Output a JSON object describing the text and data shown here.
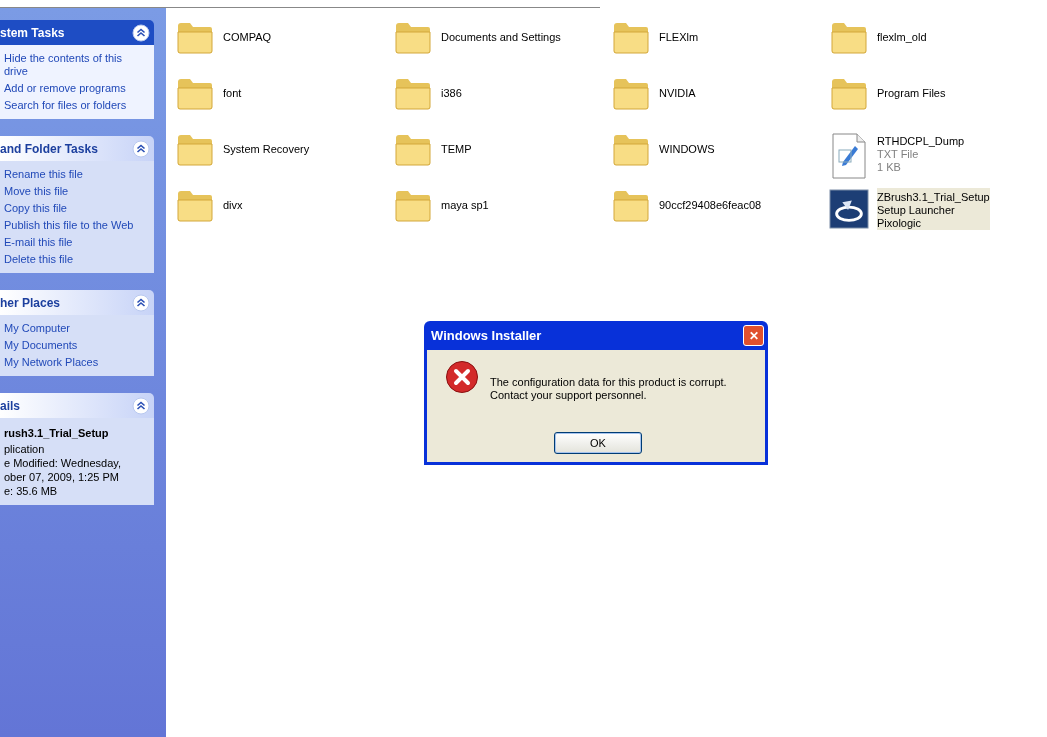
{
  "sidebar": {
    "sections": [
      {
        "title": "stem Tasks",
        "special": true,
        "kind": "links",
        "links": [
          "Hide the contents of this drive",
          "Add or remove programs",
          "Search for files or folders"
        ]
      },
      {
        "title": "and Folder Tasks",
        "special": false,
        "kind": "links",
        "links": [
          "Rename this file",
          "Move this file",
          "Copy this file",
          "Publish this file to the Web",
          "E-mail this file",
          "Delete this file"
        ]
      },
      {
        "title": "her Places",
        "special": false,
        "kind": "links",
        "links": [
          "My Computer",
          "My Documents",
          "My Network Places"
        ]
      },
      {
        "title": "ails",
        "special": false,
        "kind": "details",
        "name": "rush3.1_Trial_Setup",
        "lines": [
          "plication",
          "e Modified: Wednesday,",
          "ober 07, 2009, 1:25 PM",
          "e: 35.6 MB"
        ]
      }
    ]
  },
  "files": [
    {
      "kind": "folder",
      "name": "COMPAQ",
      "selected": false
    },
    {
      "kind": "folder",
      "name": "Documents and Settings",
      "selected": false
    },
    {
      "kind": "folder",
      "name": "FLEXlm",
      "selected": false
    },
    {
      "kind": "folder",
      "name": "flexlm_old",
      "selected": false
    },
    {
      "kind": "folder",
      "name": "font",
      "selected": false
    },
    {
      "kind": "folder",
      "name": "i386",
      "selected": false
    },
    {
      "kind": "folder",
      "name": "NVIDIA",
      "selected": false
    },
    {
      "kind": "folder",
      "name": "Program Files",
      "selected": false
    },
    {
      "kind": "folder",
      "name": "System Recovery",
      "selected": false
    },
    {
      "kind": "folder",
      "name": "TEMP",
      "selected": false
    },
    {
      "kind": "folder",
      "name": "WINDOWS",
      "selected": false
    },
    {
      "kind": "text",
      "name": "RTHDCPL_Dump",
      "details": [
        "TXT File",
        "1 KB"
      ],
      "selected": false
    },
    {
      "kind": "folder",
      "name": "divx",
      "selected": false
    },
    {
      "kind": "folder",
      "name": "maya sp1",
      "selected": false
    },
    {
      "kind": "folder",
      "name": "90ccf29408e6feac08",
      "selected": false
    },
    {
      "kind": "app",
      "name": "ZBrush3.1_Trial_Setup",
      "details": [
        "Setup Launcher",
        "Pixologic"
      ],
      "selected": true
    }
  ],
  "dialog": {
    "title": "Windows Installer",
    "close": "✕",
    "message_lines": [
      "The configuration data for this product is corrupt.",
      "Contact your support personnel."
    ],
    "button": "OK"
  }
}
